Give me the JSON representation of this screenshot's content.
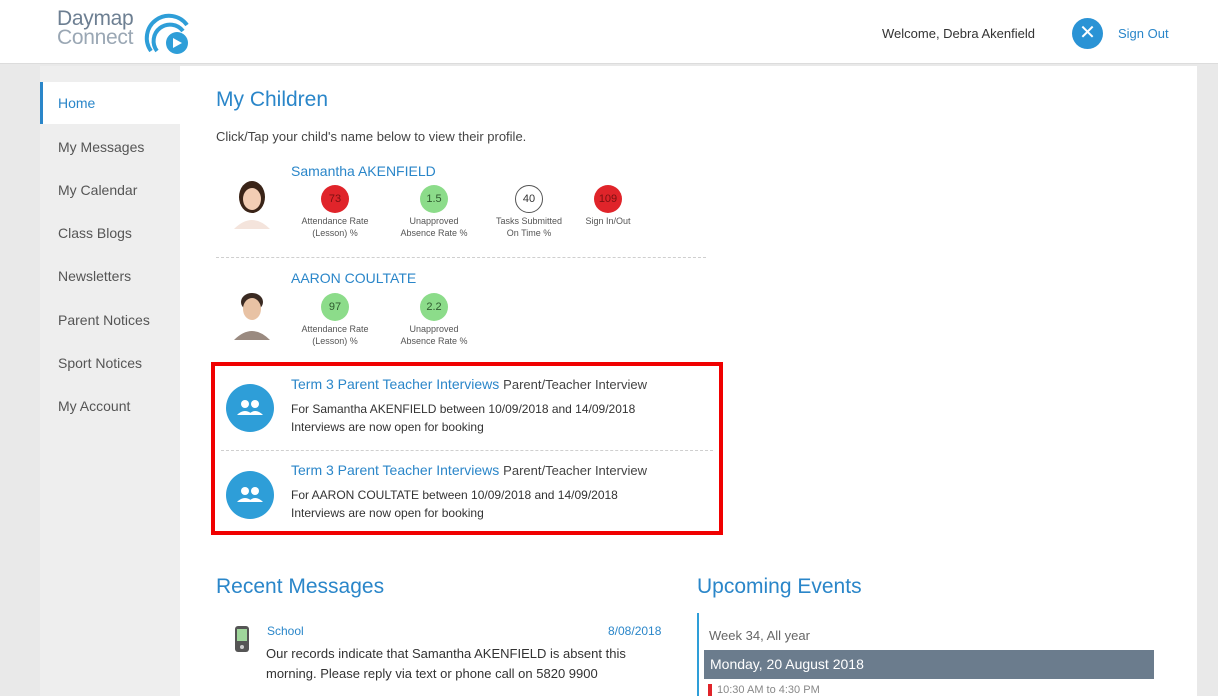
{
  "header": {
    "logo_line1": "Daymap",
    "logo_line2": "Connect",
    "welcome": "Welcome, Debra Akenfield",
    "sign_out": "Sign Out"
  },
  "sidebar": {
    "items": [
      {
        "label": "Home"
      },
      {
        "label": "My Messages"
      },
      {
        "label": "My Calendar"
      },
      {
        "label": "Class Blogs"
      },
      {
        "label": "Newsletters"
      },
      {
        "label": "Parent Notices"
      },
      {
        "label": "Sport Notices"
      },
      {
        "label": "My Account"
      }
    ]
  },
  "children_section": {
    "title": "My Children",
    "intro": "Click/Tap your child's name below to view their profile.",
    "children": [
      {
        "name": "Samantha AKENFIELD",
        "stats": [
          {
            "value": "73",
            "label1": "Attendance Rate",
            "label2": "(Lesson) %",
            "status": "red"
          },
          {
            "value": "1.5",
            "label1": "Unapproved",
            "label2": "Absence Rate %",
            "status": "green"
          },
          {
            "value": "40",
            "label1": "Tasks Submitted",
            "label2": "On Time %",
            "status": "neutral"
          },
          {
            "value": "109",
            "label1": "Sign In/Out",
            "label2": "",
            "status": "red"
          }
        ]
      },
      {
        "name": "AARON COULTATE",
        "stats": [
          {
            "value": "97",
            "label1": "Attendance Rate",
            "label2": "(Lesson) %",
            "status": "green"
          },
          {
            "value": "2.2",
            "label1": "Unapproved",
            "label2": "Absence Rate %",
            "status": "green"
          }
        ]
      }
    ]
  },
  "notices": [
    {
      "icon": "people-icon",
      "title": "Term 3 Parent Teacher Interviews",
      "type": "Parent/Teacher Interview",
      "line1": "For Samantha AKENFIELD between 10/09/2018 and 14/09/2018",
      "line2": "Interviews are now open for booking"
    },
    {
      "icon": "people-icon",
      "title": "Term 3 Parent Teacher Interviews",
      "type": "Parent/Teacher Interview",
      "line1": "For AARON COULTATE between 10/09/2018 and 14/09/2018",
      "line2": "Interviews are now open for booking"
    }
  ],
  "messages": {
    "title": "Recent Messages",
    "items": [
      {
        "from": "School",
        "date": "8/08/2018",
        "body": "Our records indicate that Samantha AKENFIELD is absent this morning. Please reply via text or phone call on 5820 9900"
      }
    ]
  },
  "events": {
    "title": "Upcoming Events",
    "week": "Week 34, All year",
    "day": "Monday, 20 August 2018",
    "first_time": "10:30 AM to 4:30 PM"
  },
  "colors": {
    "accent": "#2a86c9",
    "alert_red": "#e0242a",
    "ok_green": "#8cdc8a",
    "highlight_border": "#f00000"
  }
}
